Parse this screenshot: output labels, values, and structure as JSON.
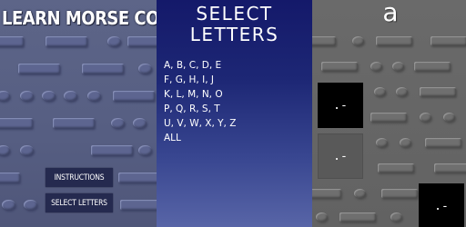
{
  "title_screen": {
    "app_title": "LEARN MORSE CODE",
    "menu": {
      "instructions_label": "INSTRUCTIONS",
      "select_letters_label": "SELECT LETTERS"
    }
  },
  "select_screen": {
    "heading": "SELECT\nLETTERS",
    "letter_groups": [
      "A, B, C, D, E",
      "F, G, H, I, J",
      "K, L, M, N, O",
      "P, Q, R, S, T",
      "U, V, W, X, Y, Z",
      "ALL"
    ]
  },
  "quiz_screen": {
    "current_letter": "a",
    "answer_options": [
      ".-",
      ".-",
      ".-"
    ]
  },
  "colors": {
    "title_bg": "#5d6588",
    "select_bg_top": "#14196a",
    "select_bg_bottom": "#5865a7",
    "button_bg": "#252a4f",
    "quiz_bg": "#666666",
    "answer_dark": "#000000",
    "answer_grey": "#595959"
  }
}
